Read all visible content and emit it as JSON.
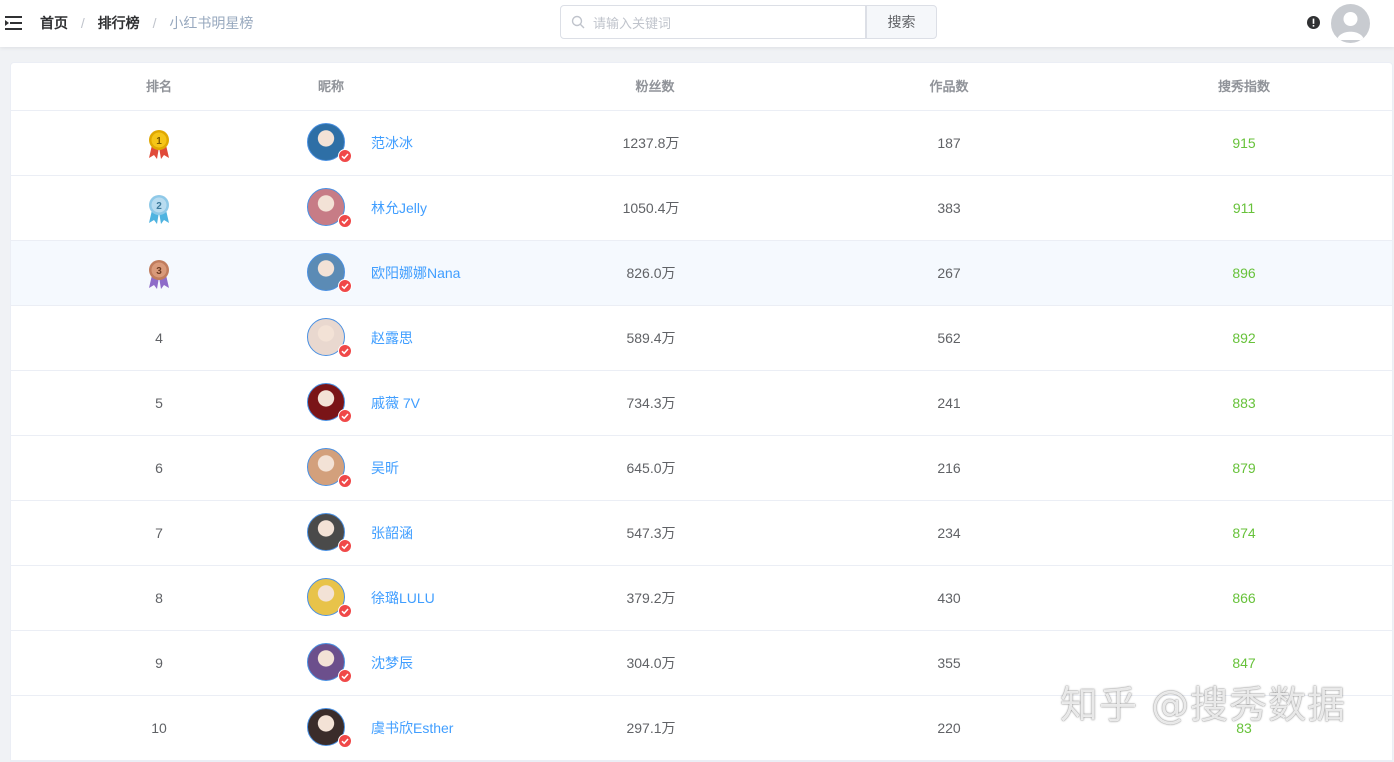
{
  "header": {
    "breadcrumb": [
      "首页",
      "排行榜",
      "小红书明星榜"
    ],
    "breadcrumb_sep": "/",
    "search": {
      "placeholder": "请输入关键词",
      "value": "",
      "button_label": "搜索"
    }
  },
  "table": {
    "columns": [
      "排名",
      "昵称",
      "粉丝数",
      "作品数",
      "搜秀指数"
    ],
    "rows": [
      {
        "rank": "1",
        "medal": "gold",
        "name": "范冰冰",
        "fans": "1237.8万",
        "works": "187",
        "index": "915",
        "avatar_color": "#2e6fa6"
      },
      {
        "rank": "2",
        "medal": "silver",
        "name": "林允Jelly",
        "fans": "1050.4万",
        "works": "383",
        "index": "911",
        "avatar_color": "#c77c86"
      },
      {
        "rank": "3",
        "medal": "bronze",
        "name": "欧阳娜娜Nana",
        "fans": "826.0万",
        "works": "267",
        "index": "896",
        "avatar_color": "#5b8bb5"
      },
      {
        "rank": "4",
        "medal": "",
        "name": "赵露思",
        "fans": "589.4万",
        "works": "562",
        "index": "892",
        "avatar_color": "#e9d8cf"
      },
      {
        "rank": "5",
        "medal": "",
        "name": "戚薇 7V",
        "fans": "734.3万",
        "works": "241",
        "index": "883",
        "avatar_color": "#7a1417"
      },
      {
        "rank": "6",
        "medal": "",
        "name": "吴昕",
        "fans": "645.0万",
        "works": "216",
        "index": "879",
        "avatar_color": "#d3a07c"
      },
      {
        "rank": "7",
        "medal": "",
        "name": "张韶涵",
        "fans": "547.3万",
        "works": "234",
        "index": "874",
        "avatar_color": "#4a4a4a"
      },
      {
        "rank": "8",
        "medal": "",
        "name": "徐璐LULU",
        "fans": "379.2万",
        "works": "430",
        "index": "866",
        "avatar_color": "#e8c34a"
      },
      {
        "rank": "9",
        "medal": "",
        "name": "沈梦辰",
        "fans": "304.0万",
        "works": "355",
        "index": "847",
        "avatar_color": "#6c4f8c"
      },
      {
        "rank": "10",
        "medal": "",
        "name": "虞书欣Esther",
        "fans": "297.1万",
        "works": "220",
        "index": "83",
        "avatar_color": "#3a2c2a"
      }
    ]
  },
  "watermark": "知乎 @搜秀数据",
  "colors": {
    "accent": "#409eff",
    "index_green": "#67c23a",
    "verified_red": "#f04848",
    "gold": "#f5c518",
    "silver": "#8fc9e8",
    "bronze": "#c07c5c"
  },
  "icons": {
    "menu": "menu-fold-icon",
    "search": "search-icon",
    "alert": "exclamation-circle-icon",
    "user": "user-avatar-icon",
    "verified": "verified-check-icon"
  }
}
